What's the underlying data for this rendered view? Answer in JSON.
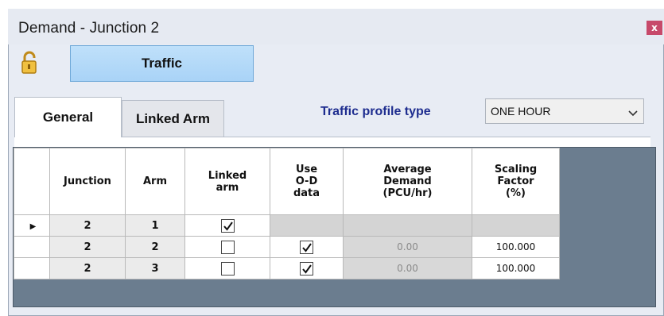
{
  "window": {
    "title": "Demand - Junction 2",
    "close_glyph": "x"
  },
  "toolbar": {
    "lock_icon": "padlock-open-icon",
    "traffic_label": "Traffic"
  },
  "tabs": [
    {
      "label": "General",
      "active": true
    },
    {
      "label": "Linked Arm",
      "active": false
    }
  ],
  "profile": {
    "label": "Traffic profile type",
    "value": "ONE HOUR"
  },
  "grid": {
    "headers": [
      "",
      "Junction",
      "Arm",
      "Linked\narm",
      "Use\nO-D\ndata",
      "Average\nDemand\n(PCU/hr)",
      "Scaling\nFactor\n(%)"
    ],
    "rows": [
      {
        "selected": true,
        "junction": "2",
        "arm": "1",
        "linked_arm": true,
        "use_od": null,
        "average_demand": "",
        "scaling_factor": ""
      },
      {
        "selected": false,
        "junction": "2",
        "arm": "2",
        "linked_arm": false,
        "use_od": true,
        "average_demand": "0.00",
        "scaling_factor": "100.000"
      },
      {
        "selected": false,
        "junction": "2",
        "arm": "3",
        "linked_arm": false,
        "use_od": true,
        "average_demand": "0.00",
        "scaling_factor": "100.000"
      }
    ],
    "row_pointer_glyph": "▶"
  },
  "colors": {
    "accent_button": "#a9d3f7",
    "close": "#c7496a",
    "profile_label": "#1e2d8f",
    "grid_background": "#6b7d8f"
  }
}
